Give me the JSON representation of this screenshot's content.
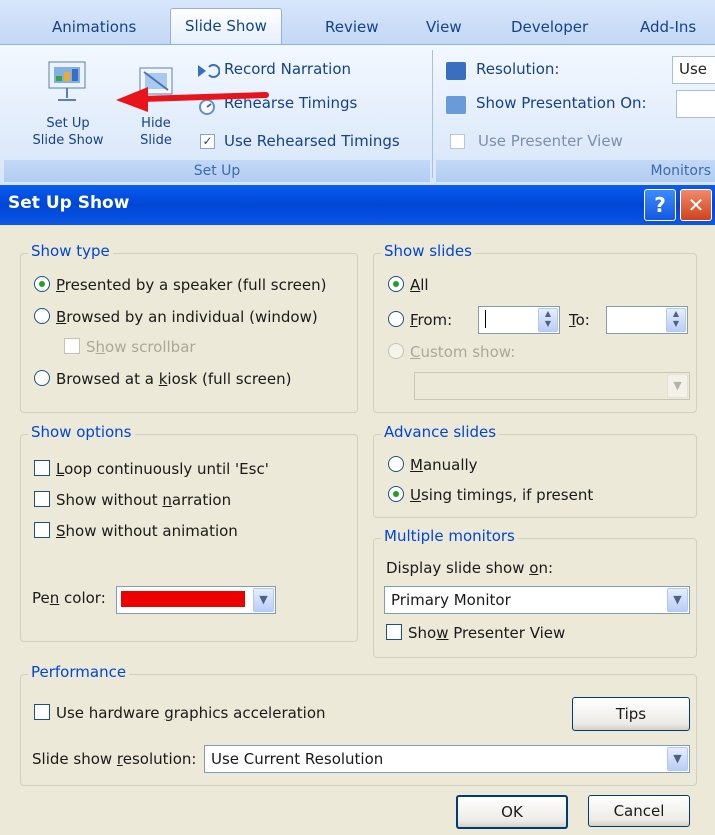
{
  "ribbon": {
    "tabs": [
      "Animations",
      "Slide Show",
      "Review",
      "View",
      "Developer",
      "Add-Ins"
    ],
    "active_tab": "Slide Show",
    "setup_group": {
      "label": "Set Up",
      "setup_button": [
        "Set Up",
        "Slide Show"
      ],
      "hide_button": [
        "Hide",
        "Slide"
      ],
      "record_narration": "Record Narration",
      "rehearse_timings": "Rehearse Timings",
      "use_rehearsed": "Use Rehearsed Timings",
      "use_rehearsed_checked": "✓"
    },
    "monitors_group": {
      "label": "Monitors",
      "resolution": "Resolution:",
      "resolution_value": "Use",
      "show_on": "Show Presentation On:",
      "presenter_view": "Use Presenter View"
    },
    "arrow_color": "#e8141c"
  },
  "dialog": {
    "title": "Set Up Show",
    "help_button": "?",
    "close_button": "✕",
    "show_type": {
      "legend": "Show type",
      "speaker": {
        "pre": "",
        "key": "P",
        "post": "resented by a speaker (full screen)"
      },
      "individual": {
        "pre": "",
        "key": "B",
        "post": "rowsed by an individual (window)"
      },
      "scrollbar": {
        "pre": "S",
        "key": "h",
        "post": "ow scrollbar"
      },
      "kiosk": {
        "pre": "Browsed at a ",
        "key": "k",
        "post": "iosk (full screen)"
      }
    },
    "show_slides": {
      "legend": "Show slides",
      "all": {
        "key": "A",
        "post": "ll"
      },
      "from": {
        "key": "F",
        "post": "rom:"
      },
      "to": {
        "key": "T",
        "post": "o:"
      },
      "custom": {
        "key": "C",
        "post": "ustom show:"
      }
    },
    "show_options": {
      "legend": "Show options",
      "loop": {
        "pre": "",
        "key": "L",
        "post": "oop continuously until 'Esc'"
      },
      "narration": {
        "pre": "Show without ",
        "key": "n",
        "post": "arration"
      },
      "animation": {
        "pre": "",
        "key": "S",
        "post": "how without animation"
      },
      "pen_color": {
        "pre": "Pe",
        "key": "n",
        "post": " color:"
      },
      "pen_color_value": "#ee0000"
    },
    "advance_slides": {
      "legend": "Advance slides",
      "manually": {
        "key": "M",
        "post": "anually"
      },
      "timings": {
        "key": "U",
        "post": "sing timings, if present"
      }
    },
    "multiple_monitors": {
      "legend": "Multiple monitors",
      "display_on": {
        "pre": "Display slide show ",
        "key": "o",
        "post": "n:"
      },
      "monitor_value": "Primary Monitor",
      "presenter_view": {
        "pre": "Sho",
        "key": "w",
        "post": " Presenter View"
      }
    },
    "performance": {
      "legend": "Performance",
      "hardware": {
        "pre": "Use hardware ",
        "key": "g",
        "post": "raphics acceleration"
      },
      "tips": "Tips",
      "resolution_label": {
        "pre": "Slide show ",
        "key": "r",
        "post": "esolution:"
      },
      "resolution_value": "Use Current Resolution"
    },
    "ok": "OK",
    "cancel": "Cancel"
  }
}
